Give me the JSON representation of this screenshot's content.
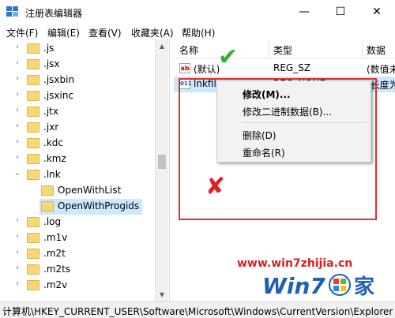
{
  "window": {
    "title": "注册表编辑器",
    "minimize_glyph": "—",
    "maximize_glyph": "☐",
    "close_glyph": "✕"
  },
  "menu": [
    "文件(F)",
    "编辑(E)",
    "查看(V)",
    "收藏夹(A)",
    "帮助(H)"
  ],
  "tree": {
    "items": [
      {
        "label": ".js",
        "expandable": true
      },
      {
        "label": ".jsx",
        "expandable": true
      },
      {
        "label": ".jsxbin",
        "expandable": true
      },
      {
        "label": ".jsxinc",
        "expandable": true
      },
      {
        "label": ".jtx",
        "expandable": true
      },
      {
        "label": ".jxr",
        "expandable": true
      },
      {
        "label": ".kdc",
        "expandable": true
      },
      {
        "label": ".kmz",
        "expandable": true
      },
      {
        "label": ".lnk",
        "expandable": true,
        "expanded": true
      },
      {
        "label": "OpenWithList",
        "expandable": false,
        "child": true
      },
      {
        "label": "OpenWithProgids",
        "expandable": false,
        "child": true,
        "selected": true
      },
      {
        "label": ".log",
        "expandable": true
      },
      {
        "label": ".m1v",
        "expandable": true
      },
      {
        "label": ".m2t",
        "expandable": true
      },
      {
        "label": ".m2ts",
        "expandable": true
      },
      {
        "label": ".m2v",
        "expandable": true
      }
    ]
  },
  "list": {
    "columns": [
      "名称",
      "类型",
      "数据"
    ],
    "rows": [
      {
        "icon": "string-value-icon",
        "icon_text": "ab",
        "name": "(默认)",
        "type": "REG_SZ",
        "data": "(数值未"
      },
      {
        "icon": "binary-value-icon",
        "icon_text": "011",
        "name": "lnkfile",
        "type": "REG_NONE",
        "data": "(长度为"
      }
    ]
  },
  "context_menu": {
    "items": [
      "修改(M)...",
      "修改二进制数据(B)...",
      "删除(D)",
      "重命名(R)"
    ]
  },
  "annotations": {
    "check_glyph": "✔",
    "cross_glyph": "✘",
    "box_color": "#e03030"
  },
  "status": "计算机\\HKEY_CURRENT_USER\\Software\\Microsoft\\Windows\\CurrentVersion\\Explorer",
  "watermark": {
    "url": "www.win7zhijia.cn",
    "logo_text": "Win7",
    "logo_suffix": "家"
  }
}
